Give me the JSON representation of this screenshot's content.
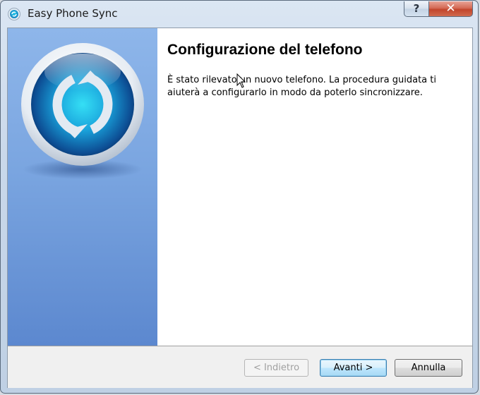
{
  "window": {
    "title": "Easy Phone Sync",
    "help_label": "?",
    "close_label": "✕",
    "app_icon": "sync-icon"
  },
  "side_panel": {
    "logo": "sync-logo-icon"
  },
  "content": {
    "heading": "Configurazione del telefono",
    "body": "È stato rilevato un nuovo telefono. La procedura guidata ti aiuterà a configurarlo in modo da poterlo sincronizzare."
  },
  "buttons": {
    "back_label": "< Indietro",
    "back_enabled": false,
    "next_label": "Avanti >",
    "cancel_label": "Annulla"
  },
  "colors": {
    "side_panel_top": "#8eb6ea",
    "side_panel_bottom": "#5c88cf",
    "close_button": "#c2452c",
    "logo_center": "#1fb8e8"
  }
}
